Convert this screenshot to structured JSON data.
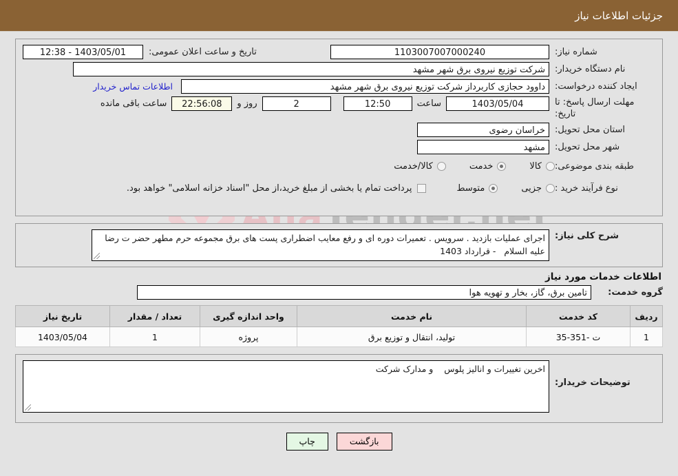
{
  "header": {
    "title": "جزئیات اطلاعات نیاز"
  },
  "form": {
    "need_number_label": "شماره نیاز:",
    "need_number_value": "1103007007000240",
    "announce_datetime_label": "تاریخ و ساعت اعلان عمومی:",
    "announce_datetime_value": "1403/05/01 - 12:38",
    "buyer_org_label": "نام دستگاه خریدار:",
    "buyer_org_value": "شرکت توزیع نیروی برق شهر مشهد",
    "requester_label": "ایجاد کننده درخواست:",
    "requester_value": "داوود حجازی کاربرداز شرکت توزیع نیروی برق شهر مشهد",
    "contact_link": "اطلاعات تماس خریدار",
    "deadline_label": "مهلت ارسال پاسخ: تا تاریخ:",
    "deadline_date": "1403/05/04",
    "deadline_time_label": "ساعت",
    "deadline_time": "12:50",
    "days_value": "2",
    "days_label": "روز و",
    "remaining_time": "22:56:08",
    "remaining_label": "ساعت باقی مانده",
    "province_label": "استان محل تحویل:",
    "province_value": "خراسان رضوی",
    "city_label": "شهر محل تحویل:",
    "city_value": "مشهد",
    "classification_label": "طبقه بندی موضوعی:",
    "classification_options": [
      {
        "label": "کالا",
        "selected": false
      },
      {
        "label": "خدمت",
        "selected": true
      },
      {
        "label": "کالا/خدمت",
        "selected": false
      }
    ],
    "process_type_label": "نوع فرآیند خرید :",
    "process_type_options": [
      {
        "label": "جزیی",
        "selected": false
      },
      {
        "label": "متوسط",
        "selected": true
      }
    ],
    "treasury_checkbox_text": "پرداخت تمام یا بخشی از مبلغ خرید،از محل \"اسناد خزانه اسلامی\" خواهد بود.",
    "treasury_checked": false
  },
  "description": {
    "label": "شرح کلی نیاز:",
    "value": "اجرای عملیات بازدید . سرویس . تعمیرات دوره ای و رفع معایب اضطراری پست های برق مجموعه حرم مطهر حضر ت رضا علیه السلام   - قرارداد 1403"
  },
  "services": {
    "section_title": "اطلاعات خدمات مورد نیاز",
    "group_label": "گروه خدمت:",
    "group_value": "تامین برق، گاز، بخار و تهویه هوا",
    "columns": [
      "ردیف",
      "کد خدمت",
      "نام خدمت",
      "واحد اندازه گیری",
      "تعداد / مقدار",
      "تاریخ نیاز"
    ],
    "rows": [
      {
        "radif": "1",
        "code": "ت -351-35",
        "name": "تولید، انتقال و توزیع برق",
        "unit": "پروژه",
        "qty": "1",
        "date": "1403/05/04"
      }
    ]
  },
  "notes": {
    "label": "توضیحات خریدار:",
    "value": "اخرین تغییرات و انالیز پلوس    و مدارک شرکت"
  },
  "footer": {
    "back_label": "بازگشت",
    "print_label": "چاپ"
  },
  "watermark": {
    "text_left": "Ana",
    "text_right": "Tender.net"
  },
  "colors": {
    "titlebar": "#8a6234",
    "link": "#2222cc",
    "back_button": "#fbd7d7",
    "print_button": "#e4f7e4"
  }
}
